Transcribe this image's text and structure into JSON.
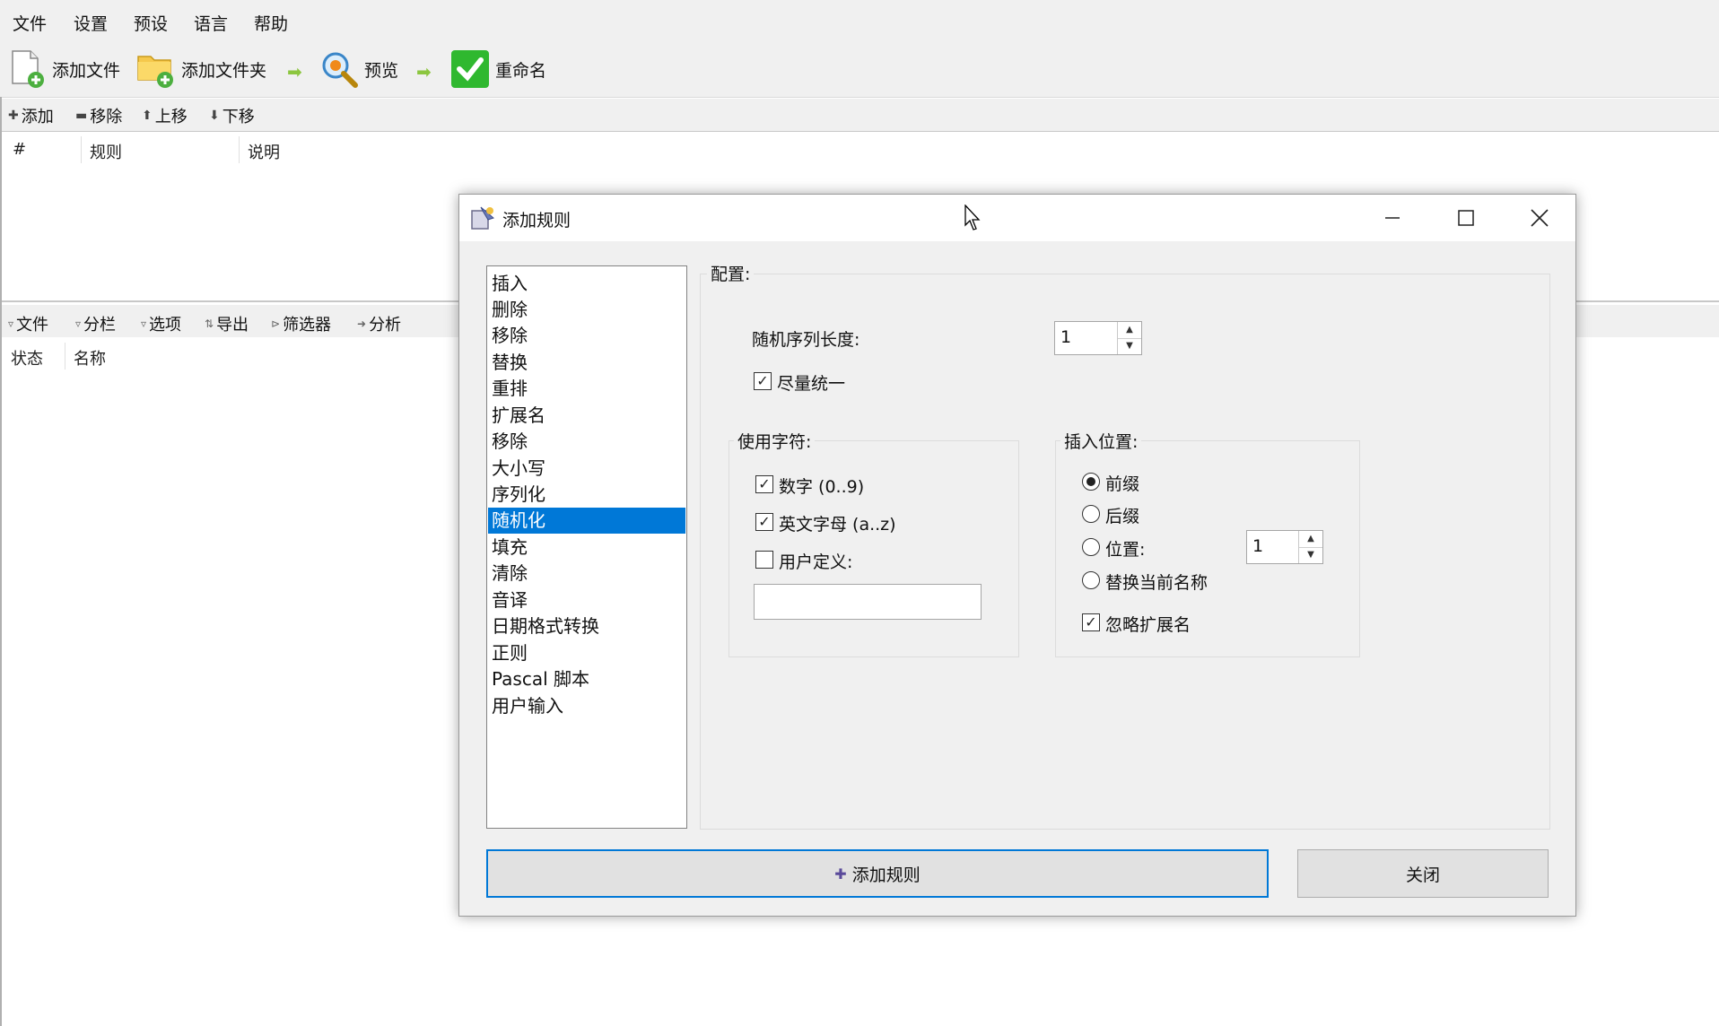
{
  "menu": [
    "文件",
    "设置",
    "预设",
    "语言",
    "帮助"
  ],
  "toolbar": {
    "add_files": "添加文件",
    "add_folder": "添加文件夹",
    "preview": "预览",
    "rename": "重命名"
  },
  "rules_toolbar": {
    "add": "添加",
    "remove": "移除",
    "move_up": "上移",
    "move_down": "下移"
  },
  "rules_columns": [
    "#",
    "规则",
    "说明"
  ],
  "files_toolbar": [
    "文件",
    "分栏",
    "选项",
    "导出",
    "筛选器",
    "分析"
  ],
  "files_columns": [
    "状态",
    "名称"
  ],
  "dialog": {
    "title": "添加规则",
    "rule_types": [
      "插入",
      "删除",
      "移除",
      "替换",
      "重排",
      "扩展名",
      "移除",
      "大小写",
      "序列化",
      "随机化",
      "填充",
      "清除",
      "音译",
      "日期格式转换",
      "正则",
      "Pascal 脚本",
      "用户输入"
    ],
    "selected_rule": "随机化",
    "config_label": "配置:",
    "seq_length_label": "随机序列长度:",
    "seq_length_value": "1",
    "unique_label": "尽量统一",
    "unique_checked": true,
    "chars_group": "使用字符:",
    "digits_label": "数字 (0..9)",
    "digits_checked": true,
    "letters_label": "英文字母 (a..z)",
    "letters_checked": true,
    "user_defined_label": "用户定义:",
    "user_defined_checked": false,
    "user_defined_value": "",
    "position_group": "插入位置:",
    "prefix_label": "前缀",
    "suffix_label": "后缀",
    "position_label": "位置:",
    "position_value": "1",
    "replace_label": "替换当前名称",
    "selected_position": "前缀",
    "ignore_ext_label": "忽略扩展名",
    "ignore_ext_checked": true,
    "add_rule_button": "添加规则",
    "close_button": "关闭"
  },
  "colors": {
    "selection": "#0078d7",
    "toolbar_bg": "#f0f0f0",
    "arrow_green": "#8cc63f"
  }
}
